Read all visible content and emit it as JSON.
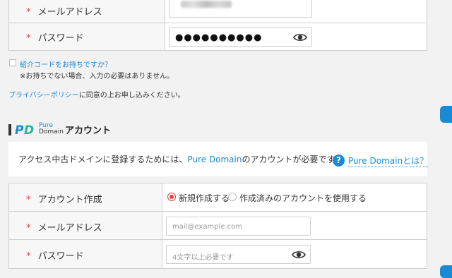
{
  "login_form": {
    "required_mark": "*",
    "email_label": "メールアドレス",
    "password_label": "パスワード",
    "password_mask": "●●●●●●●●●●"
  },
  "referral": {
    "checkbox_label": "紹介コードをお持ちですか？",
    "note": "※お持ちでない場合、入力の必要はありません。"
  },
  "privacy": {
    "link_text": "プライバシーポリシー",
    "suffix_text": "に同意の上お申し込みください。"
  },
  "account_section": {
    "logo_mark": "PD",
    "logo_line1": "Pure",
    "logo_line2": "Domain",
    "title": "アカウント"
  },
  "info": {
    "text_before": "アクセス中古ドメインに登録するためには、",
    "brand": "Pure Domain",
    "text_after": "のアカウントが必要です。",
    "help_icon": "?",
    "help_link": "Pure Domainとは？"
  },
  "account_form": {
    "required_mark": "*",
    "create_label": "アカウント作成",
    "option_new": "新規作成する",
    "option_existing": "作成済みのアカウントを使用する",
    "selected_option": "new",
    "email_label": "メールアドレス",
    "email_placeholder": "mail@example.com",
    "password_label": "パスワード",
    "password_placeholder": "4文字以上必要です"
  },
  "colors": {
    "accent": "#1a8ad6",
    "required": "#e2413d",
    "background": "#f2f2f2"
  },
  "icons": {
    "show_password": "eye-icon",
    "help": "question-circle-icon"
  }
}
